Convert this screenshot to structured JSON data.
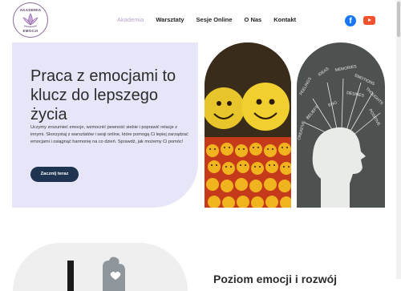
{
  "brand": {
    "top_text": "AKADEMIA",
    "bottom_text": "EMOCJI"
  },
  "nav": {
    "items": [
      {
        "label": "Akademia",
        "active": true
      },
      {
        "label": "Warsztaty",
        "active": false
      },
      {
        "label": "Sesje Online",
        "active": false
      },
      {
        "label": "O Nas",
        "active": false
      },
      {
        "label": "Kontakt",
        "active": false
      }
    ]
  },
  "social": {
    "facebook_glyph": "f",
    "icons": [
      "facebook-icon",
      "youtube-icon"
    ]
  },
  "hero": {
    "title": "Praca z emocjami to klucz do lepszego życia",
    "text": "Uczymy zrozumieć emocje, wzmocnić pewność siebie i poprawić relacje z innymi. Skorzystaj z warsztatów i sesji online, które pomogą Ci lepiej zarządzać emocjami i osiągnąć harmonię na co dzień. Sprawdź, jak możemy Ci pomóc!",
    "cta": "Zacznij teraz"
  },
  "mind_words": [
    "FEELINGS",
    "IDEAS",
    "MEMORIES",
    "EMOTIONS",
    "THOUGHTS",
    "CREATIVE",
    "POSITIVE",
    "BELIEFS",
    "DESIRES",
    "EGO"
  ],
  "lower": {
    "heading": "Poziom emocji i rozwój"
  },
  "colors": {
    "accent": "#b9a6cf",
    "hero_bg": "#e6e6f8",
    "button": "#1f3450",
    "facebook": "#1877f2",
    "youtube": "#f0522e"
  }
}
